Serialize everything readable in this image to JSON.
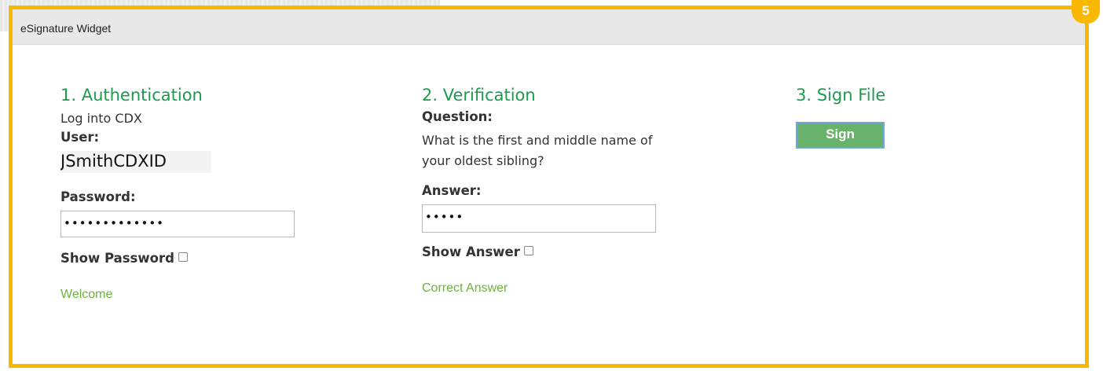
{
  "widget": {
    "title": "eSignature Widget",
    "step_number": "5"
  },
  "authentication": {
    "heading": "1. Authentication",
    "subtitle": "Log into CDX",
    "user_label": "User:",
    "user_value": "JSmithCDXID",
    "password_label": "Password:",
    "password_value": "•••••••••••••",
    "show_password_label": "Show Password",
    "show_password_checked": false,
    "status": "Welcome"
  },
  "verification": {
    "heading": "2. Verification",
    "question_label": "Question:",
    "question_text_line1": "What is the first and middle name of",
    "question_text_line2": "your oldest sibling?",
    "answer_label": "Answer:",
    "answer_value": "•••••",
    "show_answer_label": "Show Answer",
    "show_answer_checked": false,
    "status": "Correct Answer"
  },
  "sign": {
    "heading": "3. Sign File",
    "button_label": "Sign"
  },
  "colors": {
    "frame_accent": "#f9b800",
    "heading_green": "#1d9a4e",
    "status_green": "#6cb33f",
    "button_green": "#69b26b",
    "button_border": "#6fa8dc"
  }
}
